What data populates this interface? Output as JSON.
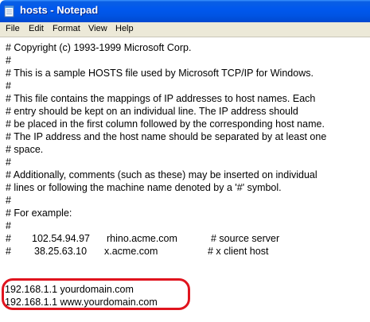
{
  "window": {
    "title": "hosts - Notepad",
    "icon": "notepad-icon"
  },
  "menubar": {
    "items": [
      "File",
      "Edit",
      "Format",
      "View",
      "Help"
    ]
  },
  "editor": {
    "lines": [
      "# Copyright (c) 1993-1999 Microsoft Corp.",
      "#",
      "# This is a sample HOSTS file used by Microsoft TCP/IP for Windows.",
      "#",
      "# This file contains the mappings of IP addresses to host names. Each",
      "# entry should be kept on an individual line. The IP address should",
      "# be placed in the first column followed by the corresponding host name.",
      "# The IP address and the host name should be separated by at least one",
      "# space.",
      "#",
      "# Additionally, comments (such as these) may be inserted on individual",
      "# lines or following the machine name denoted by a '#' symbol.",
      "#",
      "# For example:",
      "#"
    ],
    "example_rows": [
      {
        "hash": "#",
        "ip": "102.54.94.97",
        "host": "rhino.acme.com",
        "comment": "# source server"
      },
      {
        "hash": "#",
        "ip": "38.25.63.10",
        "host": "x.acme.com",
        "comment": "# x client host"
      }
    ],
    "custom_entries": [
      "192.168.1.1 yourdomain.com",
      "192.168.1.1 www.yourdomain.com"
    ]
  },
  "colors": {
    "titlebar": "#0054e3",
    "menubar": "#ece9d8",
    "highlight_oval": "#e0141e"
  }
}
